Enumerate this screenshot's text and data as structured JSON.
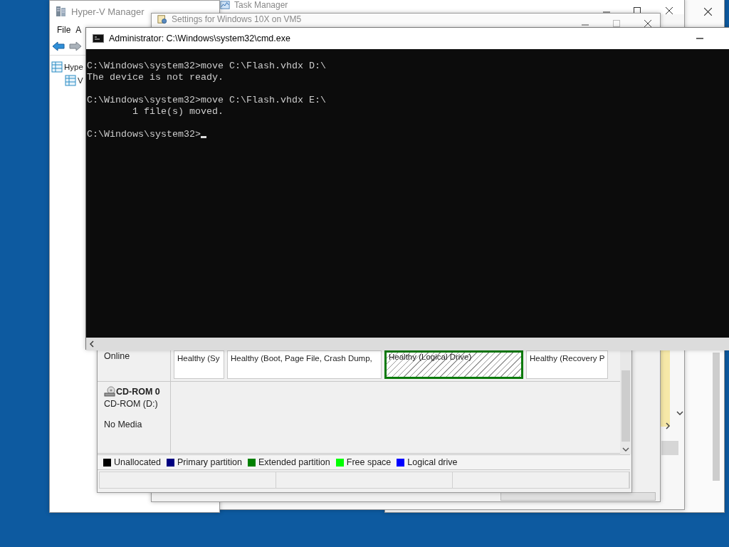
{
  "hyperv": {
    "title": "Hyper-V Manager",
    "menu": [
      "File",
      "A"
    ],
    "tree": [
      {
        "label": "Hype",
        "children": [
          {
            "label": "V"
          }
        ]
      }
    ]
  },
  "task_manager": {
    "title": "Task Manager"
  },
  "settings": {
    "title": "Settings for Windows 10X on VM5"
  },
  "disk_management": {
    "disk_status": "Online",
    "partitions": [
      {
        "label": "Healthy (Sy",
        "kind": "primary",
        "selected": false
      },
      {
        "label": "Healthy (Boot, Page File, Crash Dump,",
        "kind": "primary",
        "selected": false
      },
      {
        "label": "Healthy (Logical Drive)",
        "kind": "logical",
        "selected": true
      },
      {
        "label": "Healthy (Recovery P",
        "kind": "primary",
        "selected": false
      }
    ],
    "cdrom": {
      "name": "CD-ROM 0",
      "drive": "CD-ROM (D:)",
      "media": "No Media"
    },
    "legend": [
      {
        "label": "Unallocated",
        "color": "#000000"
      },
      {
        "label": "Primary partition",
        "color": "#000080"
      },
      {
        "label": "Extended partition",
        "color": "#008000"
      },
      {
        "label": "Free space",
        "color": "#00ff00"
      },
      {
        "label": "Logical drive",
        "color": "#0000ff"
      }
    ]
  },
  "console": {
    "title": "Administrator: C:\\Windows\\system32\\cmd.exe",
    "blocks": [
      [
        "C:\\Windows\\system32>move C:\\Flash.vhdx D:\\",
        "The device is not ready."
      ],
      [
        "C:\\Windows\\system32>move C:\\Flash.vhdx E:\\",
        "        1 file(s) moved."
      ],
      [
        "C:\\Windows\\system32>"
      ]
    ]
  }
}
